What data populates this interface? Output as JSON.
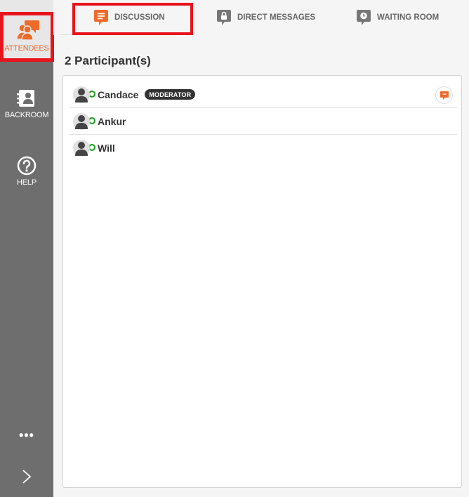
{
  "sidebar": {
    "attendees": {
      "label": "ATTENDEES",
      "icon": "attendees-chat-icon"
    },
    "backroom": {
      "label": "BACKROOM",
      "icon": "contact-card-icon"
    },
    "help": {
      "label": "HELP",
      "icon": "question-circle-icon"
    },
    "more": {
      "label": "•••",
      "icon": "more-icon"
    },
    "expand": {
      "icon": "chevron-right-icon"
    }
  },
  "tabs": [
    {
      "label": "DISCUSSION",
      "icon": "chat-lines-icon",
      "active": true
    },
    {
      "label": "DIRECT MESSAGES",
      "icon": "lock-chat-icon",
      "active": false
    },
    {
      "label": "WAITING ROOM",
      "icon": "clock-chat-icon",
      "active": false
    }
  ],
  "participants": {
    "count_label": "2 Participant(s)",
    "items": [
      {
        "name": "Candace",
        "badge": "MODERATOR",
        "status": "online"
      },
      {
        "name": "Ankur",
        "status": "online"
      },
      {
        "name": "Will",
        "status": "online"
      }
    ]
  },
  "colors": {
    "accent": "#ef6b2a",
    "sidebar": "#6e6e6e",
    "highlight": "#e8141c",
    "online": "#1a9b1a"
  }
}
